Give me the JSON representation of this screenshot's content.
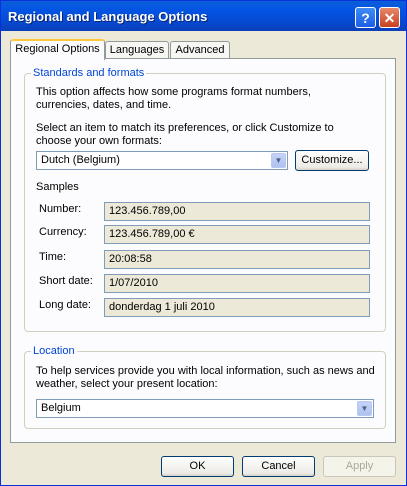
{
  "window": {
    "title": "Regional and Language Options",
    "help_glyph": "?",
    "close_glyph": "✕"
  },
  "tabs": [
    {
      "label": "Regional Options",
      "active": true
    },
    {
      "label": "Languages",
      "active": false
    },
    {
      "label": "Advanced",
      "active": false
    }
  ],
  "standards": {
    "title": "Standards and formats",
    "description": "This option affects how some programs format numbers, currencies, dates, and time.",
    "instruction": "Select an item to match its preferences, or click Customize to choose your own formats:",
    "format_value": "Dutch (Belgium)",
    "customize_label": "Customize...",
    "samples_title": "Samples",
    "samples": [
      {
        "label": "Number:",
        "value": "123.456.789,00"
      },
      {
        "label": "Currency:",
        "value": "123.456.789,00 €"
      },
      {
        "label": "Time:",
        "value": "20:08:58"
      },
      {
        "label": "Short date:",
        "value": "1/07/2010"
      },
      {
        "label": "Long date:",
        "value": "donderdag 1 juli 2010"
      }
    ]
  },
  "location": {
    "title": "Location",
    "description": "To help services provide you with local information, such as news and weather, select your present location:",
    "value": "Belgium"
  },
  "buttons": {
    "ok": "OK",
    "cancel": "Cancel",
    "apply": "Apply"
  },
  "colors": {
    "title_bar": "#0454e4",
    "group_title": "#0046d5",
    "active_tab_highlight": "#ffc83c"
  }
}
